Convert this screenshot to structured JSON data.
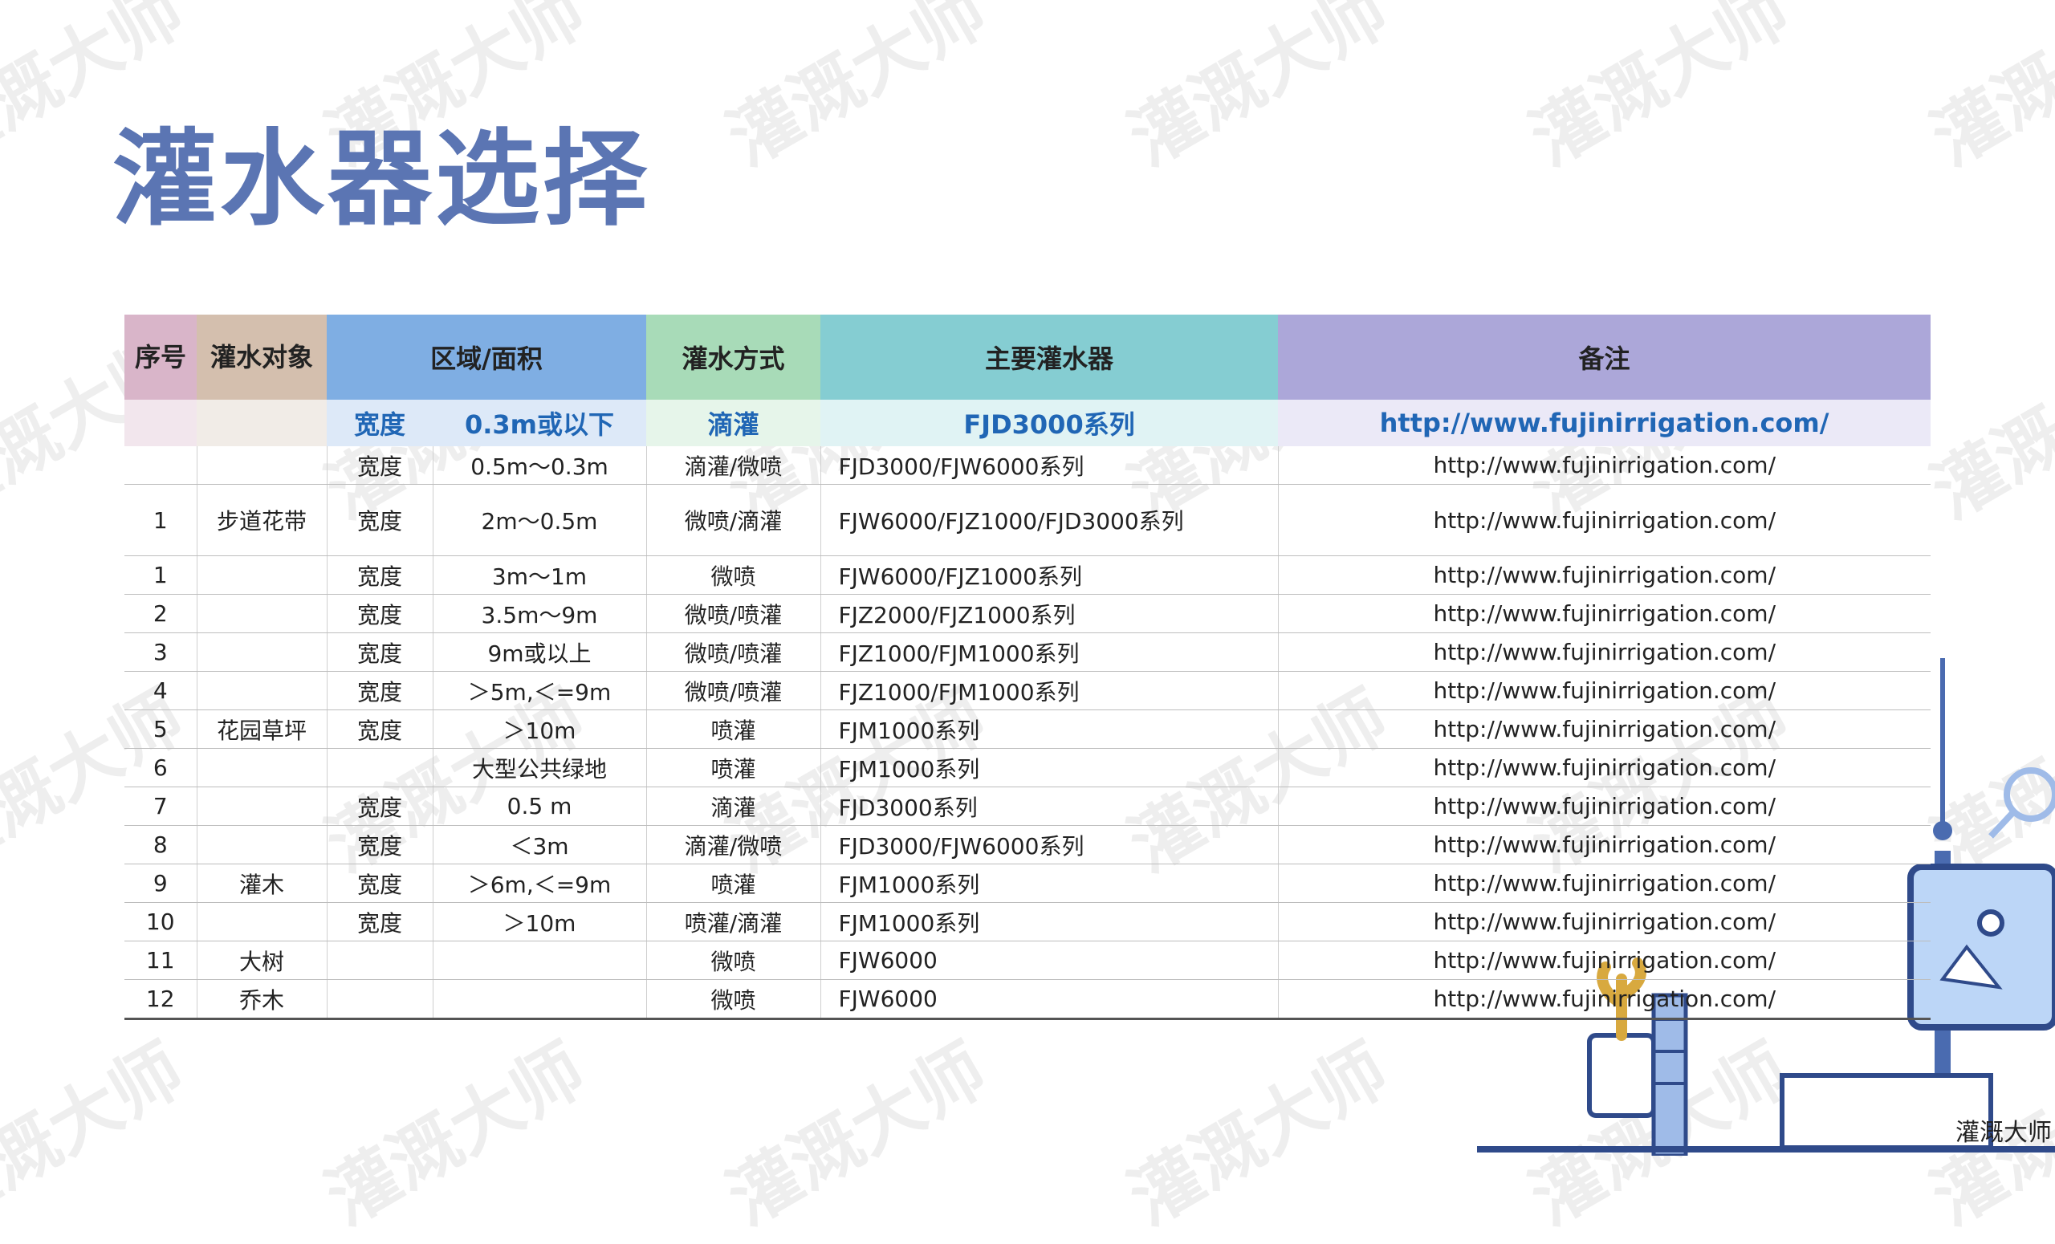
{
  "title": "灌水器选择",
  "watermark_text": "灌溉大师",
  "logo_text": "灌溉大师",
  "table": {
    "headers": [
      "序号",
      "灌水对象",
      "区域/面积",
      "灌水方式",
      "主要灌水器",
      "备注"
    ],
    "subheader": {
      "area_type": "宽度",
      "area_value": "0.3m或以下",
      "method": "滴灌",
      "main": "FJD3000系列",
      "note": "http://www.fujinirrigation.com/"
    },
    "rows": [
      {
        "no": "",
        "object": "",
        "area_type": "宽度",
        "area_value": "0.5m～0.3m",
        "method": "滴灌/微喷",
        "main": "FJD3000/FJW6000系列",
        "note": "http://www.fujinirrigation.com/"
      },
      {
        "no": "1",
        "object": "步道花带",
        "area_type": "宽度",
        "area_value": "2m～0.5m",
        "method": "微喷/滴灌",
        "main": "FJW6000/FJZ1000/FJD3000系列",
        "note": "http://www.fujinirrigation.com/"
      },
      {
        "no": "1",
        "object": "",
        "area_type": "宽度",
        "area_value": "3m～1m",
        "method": "微喷",
        "main": "FJW6000/FJZ1000系列",
        "note": "http://www.fujinirrigation.com/"
      },
      {
        "no": "2",
        "object": "",
        "area_type": "宽度",
        "area_value": "3.5m～9m",
        "method": "微喷/喷灌",
        "main": "FJZ2000/FJZ1000系列",
        "note": "http://www.fujinirrigation.com/"
      },
      {
        "no": "3",
        "object": "",
        "area_type": "宽度",
        "area_value": "9m或以上",
        "method": "微喷/喷灌",
        "main": "FJZ1000/FJM1000系列",
        "note": "http://www.fujinirrigation.com/"
      },
      {
        "no": "4",
        "object": "",
        "area_type": "宽度",
        "area_value": "＞5m,＜=9m",
        "method": "微喷/喷灌",
        "main": "FJZ1000/FJM1000系列",
        "note": "http://www.fujinirrigation.com/"
      },
      {
        "no": "5",
        "object": "花园草坪",
        "area_type": "宽度",
        "area_value": "＞10m",
        "method": "喷灌",
        "main": "FJM1000系列",
        "note": "http://www.fujinirrigation.com/"
      },
      {
        "no": "6",
        "object": "",
        "area_type": "",
        "area_value": "大型公共绿地",
        "method": "喷灌",
        "main": "FJM1000系列",
        "note": "http://www.fujinirrigation.com/"
      },
      {
        "no": "7",
        "object": "",
        "area_type": "宽度",
        "area_value": "0.5 m",
        "method": "滴灌",
        "main": "FJD3000系列",
        "note": "http://www.fujinirrigation.com/"
      },
      {
        "no": "8",
        "object": "",
        "area_type": "宽度",
        "area_value": "＜3m",
        "method": "滴灌/微喷",
        "main": "FJD3000/FJW6000系列",
        "note": "http://www.fujinirrigation.com/"
      },
      {
        "no": "9",
        "object": "灌木",
        "area_type": "宽度",
        "area_value": "＞6m,＜=9m",
        "method": "喷灌",
        "main": "FJM1000系列",
        "note": "http://www.fujinirrigation.com/"
      },
      {
        "no": "10",
        "object": "",
        "area_type": "宽度",
        "area_value": "＞10m",
        "method": "喷灌/滴灌",
        "main": "FJM1000系列",
        "note": "http://www.fujinirrigation.com/"
      },
      {
        "no": "11",
        "object": "大树",
        "area_type": "",
        "area_value": "",
        "method": "微喷",
        "main": "FJW6000",
        "note": "http://www.fujinirrigation.com/"
      },
      {
        "no": "12",
        "object": "乔木",
        "area_type": "",
        "area_value": "",
        "method": "微喷",
        "main": "FJW6000",
        "note": "http://www.fujinirrigation.com/"
      }
    ]
  }
}
